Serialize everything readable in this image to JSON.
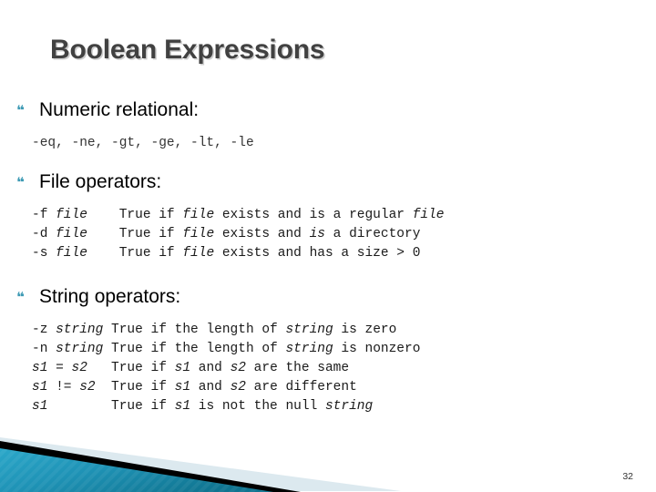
{
  "slide": {
    "title": "Boolean Expressions",
    "page_number": "32",
    "bullet_icon": "double-quote-bullet-icon",
    "colors": {
      "title": "#414141",
      "bullet": "#3f9bb5",
      "deco_teal_light": "#2fa3c4",
      "deco_teal_dark": "#17809f",
      "deco_pale": "#dce9ef",
      "deco_black": "#000000"
    }
  },
  "sections": [
    {
      "heading": "Numeric relational:",
      "lines": [
        "-eq, -ne, -gt, -ge, -lt, -le"
      ]
    },
    {
      "heading": "File operators:",
      "lines": [
        "-f file    True if file exists and is a regular file",
        "-d file    True if file exists and is a directory",
        "-s file    True if file exists and has a size > 0"
      ]
    },
    {
      "heading": "String operators:",
      "lines": [
        "-z string True if the length of string is zero",
        "-n string True if the length of string is nonzero",
        "s1 = s2   True if s1 and s2 are the same",
        "s1 != s2  True if s1 and s2 are different",
        "s1        True if s1 is not the null string"
      ]
    }
  ]
}
